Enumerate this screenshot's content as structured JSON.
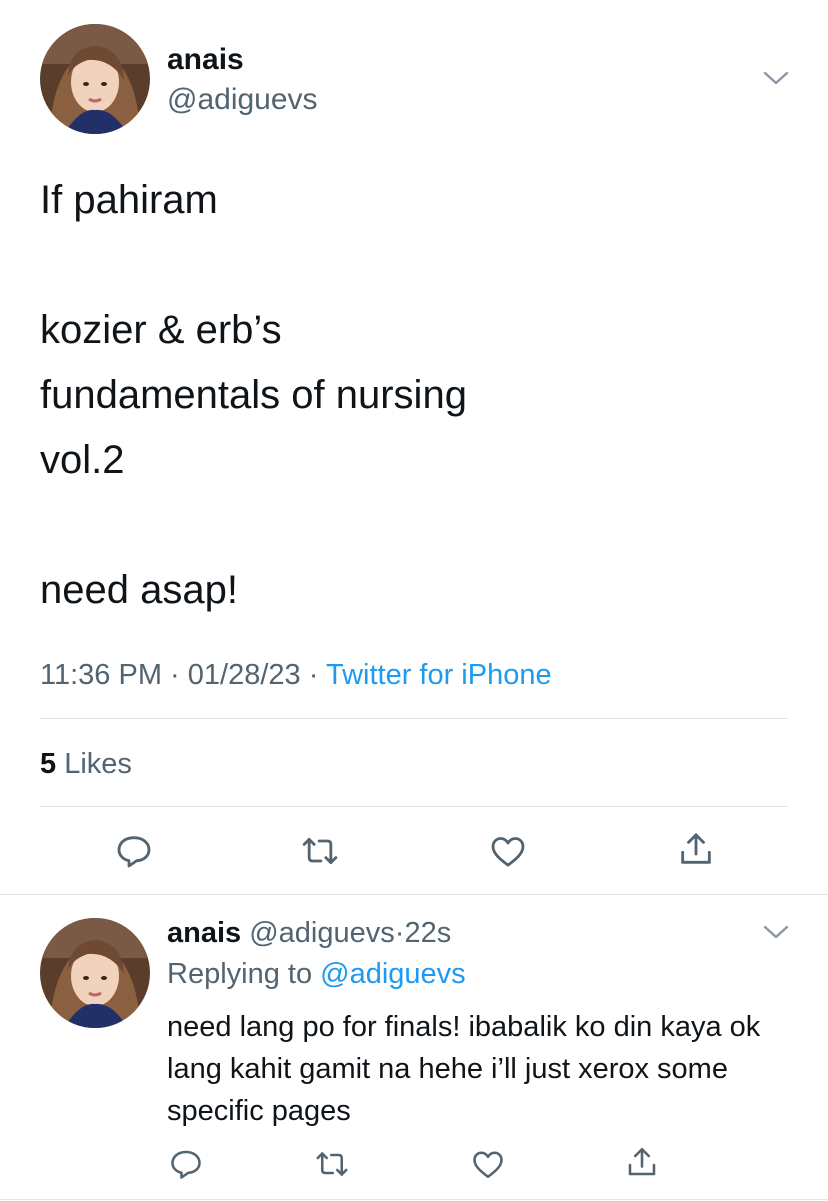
{
  "colors": {
    "accent": "#1d9bf0",
    "text": "#0f1419",
    "muted": "#536471",
    "divider": "#e3e6e9"
  },
  "main_tweet": {
    "avatar_icon": "user-avatar",
    "display_name": "anais",
    "handle": "@adiguevs",
    "more_icon": "chevron-down-icon",
    "text": "If pahiram\n\nkozier & erb’s\nfundamentals of nursing\nvol.2\n\nneed asap!",
    "time": "11:36 PM",
    "date": "01/28/23",
    "separator": "·",
    "source": "Twitter for iPhone",
    "likes_count": "5",
    "likes_label": "Likes",
    "actions": [
      "reply-icon",
      "retweet-icon",
      "like-icon",
      "share-icon"
    ]
  },
  "reply_tweet": {
    "display_name": "anais",
    "handle": "@adiguevs",
    "separator": "·",
    "age": "22s",
    "replying_prefix": "Replying to",
    "replying_handle": "@adiguevs",
    "text": "need lang po for finals! ibabalik ko din kaya ok lang kahit gamit na hehe i’ll just xerox some specific pages",
    "actions": [
      "reply-icon",
      "retweet-icon",
      "like-icon",
      "share-icon"
    ]
  }
}
